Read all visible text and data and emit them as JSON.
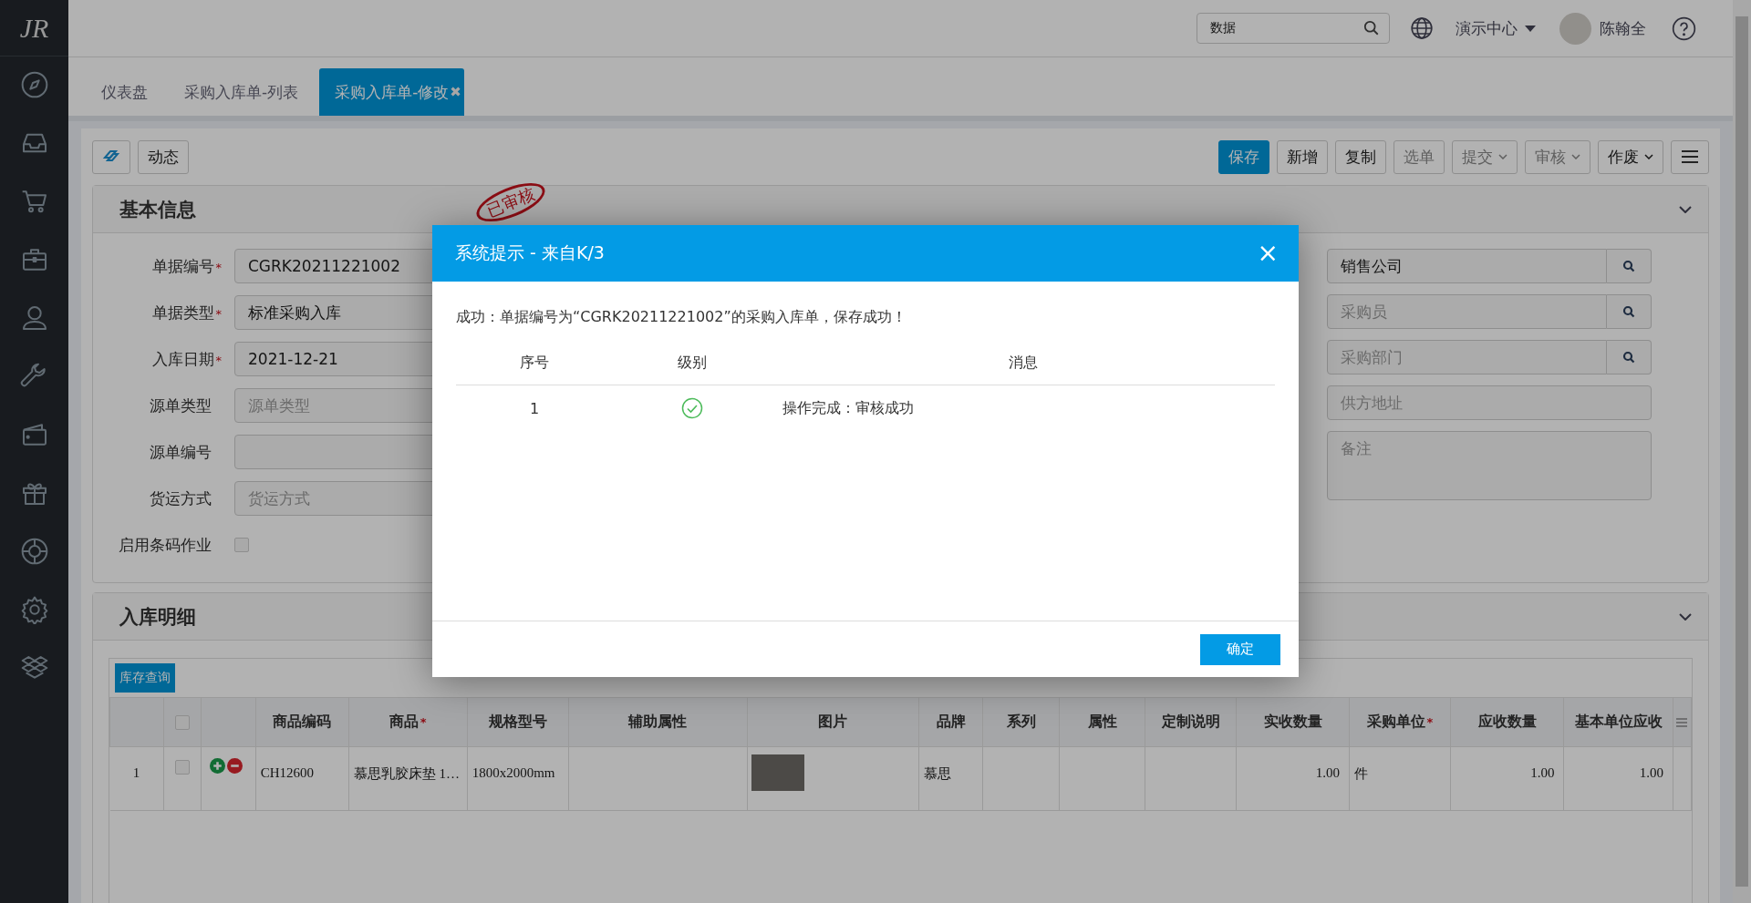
{
  "logo": "JR",
  "topbar": {
    "search": {
      "value": "数据"
    },
    "org": "演示中心",
    "user": "陈翰全"
  },
  "tabs": [
    {
      "label": "仪表盘",
      "selected": false
    },
    {
      "label": "采购入库单-列表",
      "selected": false
    },
    {
      "label": "采购入库单-修改",
      "selected": true,
      "close": "✖"
    }
  ],
  "toolbar": {
    "left": [
      {
        "kind": "icon"
      },
      {
        "kind": "text",
        "label": "动态"
      }
    ],
    "right": [
      {
        "label": "保存",
        "primary": true,
        "disabled": false,
        "dropdown": false
      },
      {
        "label": "新增",
        "primary": false,
        "disabled": false,
        "dropdown": false
      },
      {
        "label": "复制",
        "primary": false,
        "disabled": false,
        "dropdown": false
      },
      {
        "label": "选单",
        "primary": false,
        "disabled": true,
        "dropdown": false
      },
      {
        "label": "提交",
        "primary": false,
        "disabled": true,
        "dropdown": true
      },
      {
        "label": "审核",
        "primary": false,
        "disabled": true,
        "dropdown": true
      },
      {
        "label": "作废",
        "primary": false,
        "disabled": false,
        "dropdown": true
      }
    ]
  },
  "basic_info": {
    "title": "基本信息",
    "stamp": "已审核",
    "left_fields": [
      {
        "kind": "text",
        "label": "单据编号",
        "required_mark": "*",
        "value": "CGRK20211221002"
      },
      {
        "kind": "text",
        "label": "单据类型",
        "required_mark": "*",
        "value": "标准采购入库"
      },
      {
        "kind": "text",
        "label": "入库日期",
        "required_mark": "*",
        "value": "2021-12-21"
      },
      {
        "kind": "text",
        "label": "源单类型",
        "placeholder": "源单类型"
      },
      {
        "kind": "text",
        "label": "源单编号"
      },
      {
        "kind": "text",
        "label": "货运方式",
        "placeholder": "货运方式"
      },
      {
        "kind": "checkbox",
        "label": "启用条码作业",
        "checked": false
      }
    ],
    "right_fields": [
      {
        "kind": "lookup",
        "value": "销售公司"
      },
      {
        "kind": "lookup",
        "placeholder": "采购员"
      },
      {
        "kind": "lookup",
        "placeholder": "采购部门"
      },
      {
        "kind": "text",
        "placeholder": "供方地址"
      },
      {
        "kind": "textarea",
        "placeholder": "备注"
      }
    ]
  },
  "detail": {
    "title": "入库明细",
    "stock_button": "库存查询",
    "select_all": false,
    "columns": [
      {
        "label": "商品编码"
      },
      {
        "label": "商品",
        "required_mark": "*"
      },
      {
        "label": "规格型号"
      },
      {
        "label": "辅助属性"
      },
      {
        "label": "图片"
      },
      {
        "label": "品牌"
      },
      {
        "label": "系列"
      },
      {
        "label": "属性"
      },
      {
        "label": "定制说明"
      },
      {
        "label": "实收数量"
      },
      {
        "label": "采购单位",
        "required_mark": "*"
      },
      {
        "label": "应收数量"
      },
      {
        "label": "基本单位应收"
      }
    ],
    "rows": [
      {
        "index": "1",
        "checked": false,
        "cells": [
          {
            "kind": "text",
            "text": "CH12600"
          },
          {
            "kind": "text",
            "text": "慕思乳胶床垫 1…"
          },
          {
            "kind": "text",
            "text": "1800x2000mm"
          },
          {
            "kind": "blank"
          },
          {
            "kind": "photo"
          },
          {
            "kind": "text",
            "text": "慕思"
          },
          {
            "kind": "blank"
          },
          {
            "kind": "blank"
          },
          {
            "kind": "blank"
          },
          {
            "kind": "number",
            "text": "1.00"
          },
          {
            "kind": "text",
            "text": "件"
          },
          {
            "kind": "number",
            "text": "1.00"
          },
          {
            "kind": "number",
            "text": "1.00"
          }
        ]
      }
    ]
  },
  "dialog": {
    "title": "系统提示 - 来自K/3",
    "close": "×",
    "message": "成功：单据编号为“CGRK20211221002”的采购入库单，保存成功！",
    "columns": [
      "序号",
      "级别",
      "消息"
    ],
    "rows": [
      {
        "index": "1",
        "kind": "success",
        "message": "操作完成：审核成功"
      }
    ],
    "button": "确定"
  }
}
